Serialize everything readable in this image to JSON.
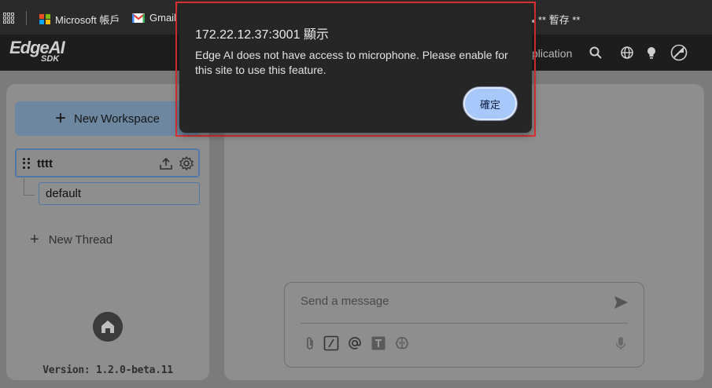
{
  "bookmarks": {
    "items": [
      {
        "label": "Microsoft 帳戶",
        "icon": "microsoft-logo"
      },
      {
        "label": "Gmail",
        "icon": "gmail-logo"
      }
    ],
    "right_label": "** 暫存 **"
  },
  "header": {
    "logo_main": "EdgeAI",
    "logo_sub": "SDK",
    "app_link_partial": "plication",
    "icons": [
      "search-icon",
      "globe-icon",
      "lightbulb-icon",
      "theme-toggle-icon"
    ]
  },
  "sidebar": {
    "new_workspace_label": "New Workspace",
    "workspace_name": "tttt",
    "thread_name": "default",
    "new_thread_label": "New Thread",
    "version": "Version: 1.2.0-beta.11"
  },
  "composer": {
    "placeholder": "Send a message",
    "tools": [
      "attachment-icon",
      "slash-command-icon",
      "mention-icon",
      "text-format-icon",
      "brain-icon",
      "microphone-icon"
    ]
  },
  "dialog": {
    "title": "172.22.12.37:3001 顯示",
    "message": "Edge AI does not have access to microphone. Please enable for this site to use this feature.",
    "ok_label": "確定"
  },
  "colors": {
    "dialog_bg": "#262626",
    "ok_button": "#a8c7fa",
    "highlight_border": "#e03030",
    "new_workspace_bg": "#6d87a0",
    "selection_border": "#4f78a6"
  }
}
